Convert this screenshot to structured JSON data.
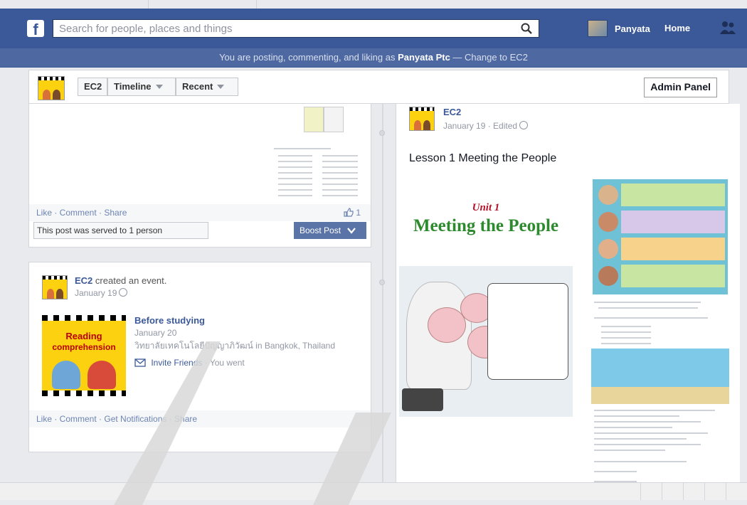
{
  "topbar": {
    "search_placeholder": "Search for people, places and things",
    "user_name": "Panyata",
    "home_label": "Home"
  },
  "notice": {
    "prefix": "You are posting, commenting, and liking as",
    "identity": "Panyata Ptc",
    "change_link": "— Change to EC2"
  },
  "pagebar": {
    "page_name": "EC2",
    "timeline_label": "Timeline",
    "recent_label": "Recent",
    "admin_label": "Admin Panel"
  },
  "post1": {
    "actions": "Like · Comment · Share",
    "likes": "1",
    "served": "This post was served to 1 person",
    "boost": "Boost Post"
  },
  "post2": {
    "author": "EC2",
    "verb": "created an event.",
    "date": "January 19",
    "event_title": "Before studying",
    "event_date": "January 20",
    "event_place": "วิทยาลัยเทคโนโลยีปัญญาภิวัฒน์ in Bangkok, Thailand",
    "invite": "Invite Friends",
    "went": "· You went",
    "image_text_1": "Reading",
    "image_text_2": "comprehension",
    "actions": "Like · Comment · Get Notifications · Share"
  },
  "post3": {
    "author": "EC2",
    "date": "January 19 · Edited",
    "text": "Lesson 1 Meeting the People",
    "unit": "Unit 1",
    "title": "Meeting the People"
  },
  "colors": {
    "brand": "#3b5998",
    "notice": "#4e69a2",
    "link": "#3b5998"
  }
}
